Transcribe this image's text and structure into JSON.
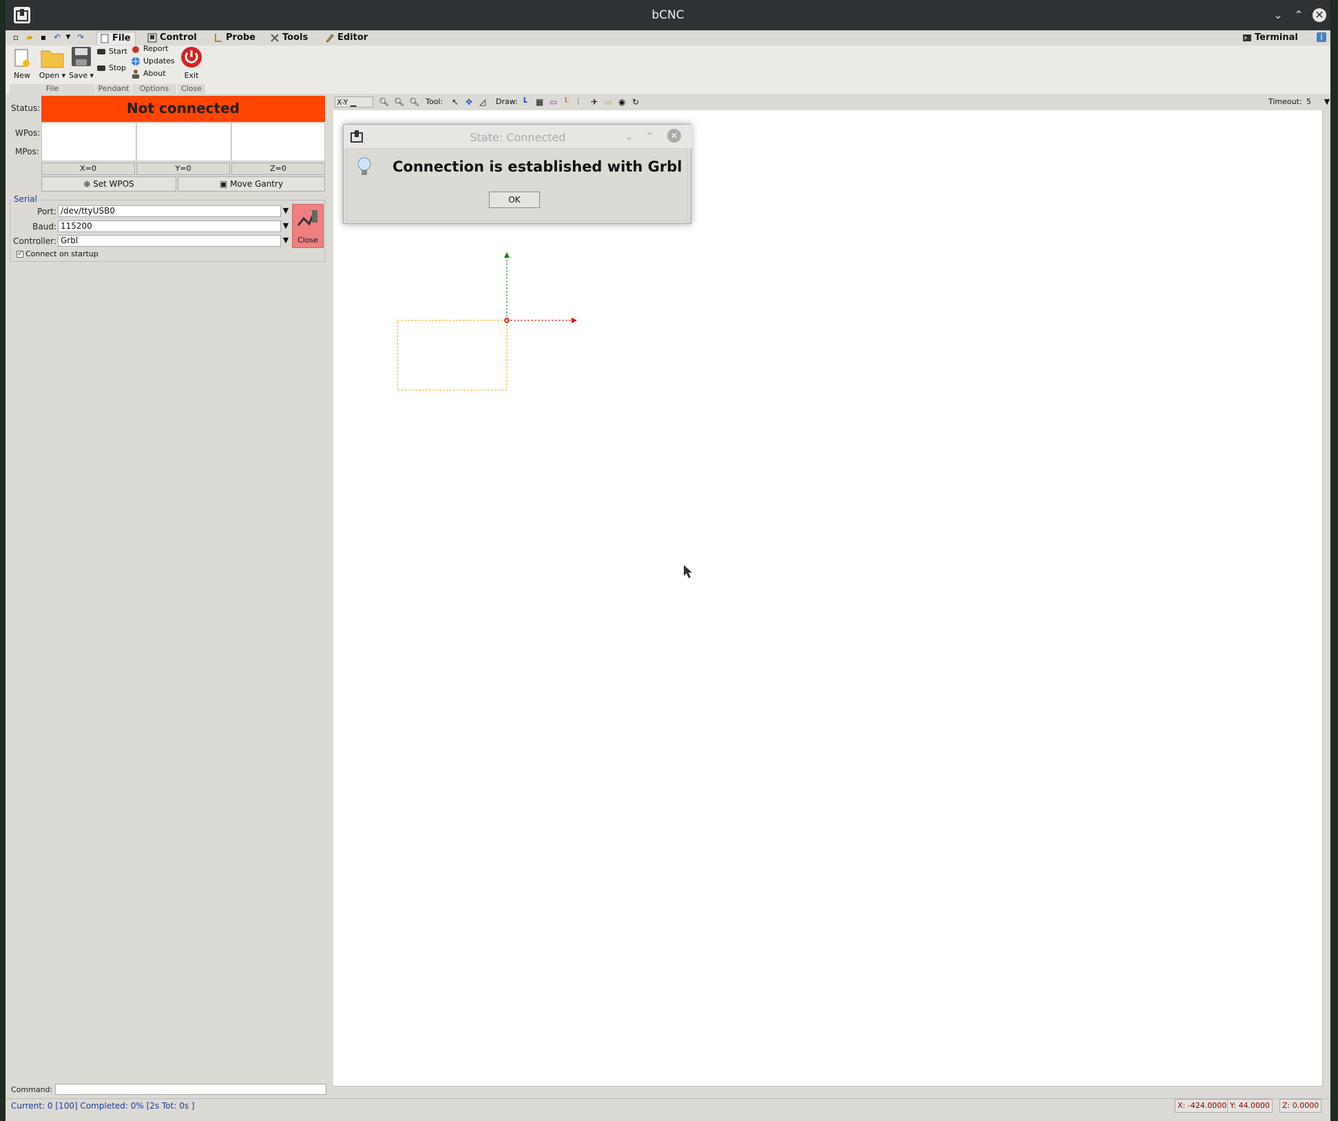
{
  "window": {
    "title": "bCNC"
  },
  "menu": {
    "tabs": [
      {
        "label": "File"
      },
      {
        "label": "Control"
      },
      {
        "label": "Probe"
      },
      {
        "label": "Tools"
      },
      {
        "label": "Editor"
      }
    ],
    "terminal_label": "Terminal"
  },
  "ribbon": {
    "file": {
      "new_label": "New",
      "open_label": "Open",
      "save_label": "Save",
      "group_label": "File"
    },
    "pendant": {
      "start_label": "Start",
      "stop_label": "Stop",
      "group_label": "Pendant"
    },
    "options": {
      "report_label": "Report",
      "updates_label": "Updates",
      "about_label": "About",
      "group_label": "Options"
    },
    "close": {
      "exit_label": "Exit",
      "group_label": "Close"
    }
  },
  "dro": {
    "status_label": "Status:",
    "status_value": "Not connected",
    "wpos_label": "WPos:",
    "mpos_label": "MPos:",
    "zero_x": "X=0",
    "zero_y": "Y=0",
    "zero_z": "Z=0",
    "set_wpos": "Set WPOS",
    "move_gantry": "Move Gantry"
  },
  "serial": {
    "title": "Serial",
    "port_label": "Port:",
    "port_value": "/dev/ttyUSB0",
    "baud_label": "Baud:",
    "baud_value": "115200",
    "controller_label": "Controller:",
    "controller_value": "Grbl",
    "connect_startup": "Connect on startup",
    "close_label": "Close"
  },
  "canvas_toolbar": {
    "view": "X-Y",
    "tool_label": "Tool:",
    "draw_label": "Draw:",
    "timeout_label": "Timeout:",
    "timeout_value": "5"
  },
  "command": {
    "label": "Command:"
  },
  "statusbar": {
    "progress": "Current: 0 [100]  Completed: 0% [2s Tot: 0s ]",
    "x": "X: -424.0000",
    "y": "Y: 44.0000",
    "z": "Z: 0.0000"
  },
  "dialog": {
    "title": "State: Connected",
    "message": "Connection is established with Grbl",
    "ok_label": "OK"
  },
  "colors": {
    "status_bg": "#ff4500",
    "axis_x": "#e00000",
    "axis_y": "#008800",
    "margin_box": "#ffa500"
  }
}
